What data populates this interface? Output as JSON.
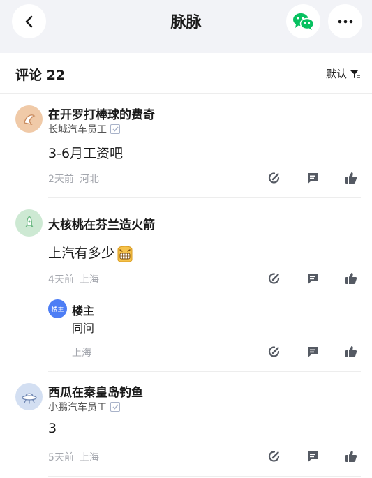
{
  "header": {
    "title": "脉脉",
    "back_icon": "chevron-left-icon",
    "share_icon": "wechat-icon",
    "more_icon": "more-dots-icon"
  },
  "comments_header": {
    "label": "评论",
    "count": "22",
    "sort_label": "默认",
    "sort_icon": "filter-sort-icon"
  },
  "comments": [
    {
      "username": "在开罗打棒球的费奇",
      "company": "长城汽车员工",
      "verified": true,
      "content": "3-6月工资吧",
      "time": "2天前",
      "location": "河北"
    },
    {
      "username": "大核桃在芬兰造火箭",
      "content": "上汽有多少",
      "emoji": "grimace-emoji",
      "time": "4天前",
      "location": "上海",
      "reply": {
        "badge": "楼主",
        "username": "楼主",
        "content": "同问",
        "location": "上海"
      }
    },
    {
      "username": "西瓜在秦皇岛钓鱼",
      "company": "小鹏汽车员工",
      "verified": true,
      "content": "3",
      "time": "5天前",
      "location": "上海"
    }
  ],
  "actions": [
    "edit-icon",
    "comment-icon",
    "like-icon"
  ],
  "colors": {
    "topbar_bg": "#f2f3f7",
    "wechat_green": "#07c160",
    "reply_badge": "#4d7ef5",
    "meta_gray": "#a4a7ae"
  }
}
